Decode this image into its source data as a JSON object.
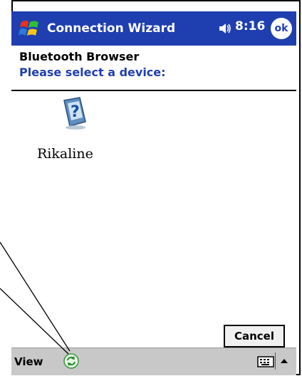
{
  "titlebar": {
    "app_title": "Connection Wizard",
    "time": "8:16",
    "ok_label": "ok"
  },
  "header": {
    "title": "Bluetooth Browser",
    "subtitle": "Please select a device:"
  },
  "devices": [
    {
      "label": "Rikaline"
    }
  ],
  "actions": {
    "cancel_label": "Cancel"
  },
  "menubar": {
    "view_label": "View"
  },
  "colors": {
    "titlebar": "#1f3fb0",
    "subtitle": "#1f3fb0",
    "menubar": "#c8c8c8"
  },
  "icons": {
    "start": "windows-flag-icon",
    "speaker": "speaker-icon",
    "device": "unknown-device-icon",
    "refresh": "refresh-icon",
    "keyboard": "keyboard-icon",
    "sip": "up-arrow-icon"
  }
}
